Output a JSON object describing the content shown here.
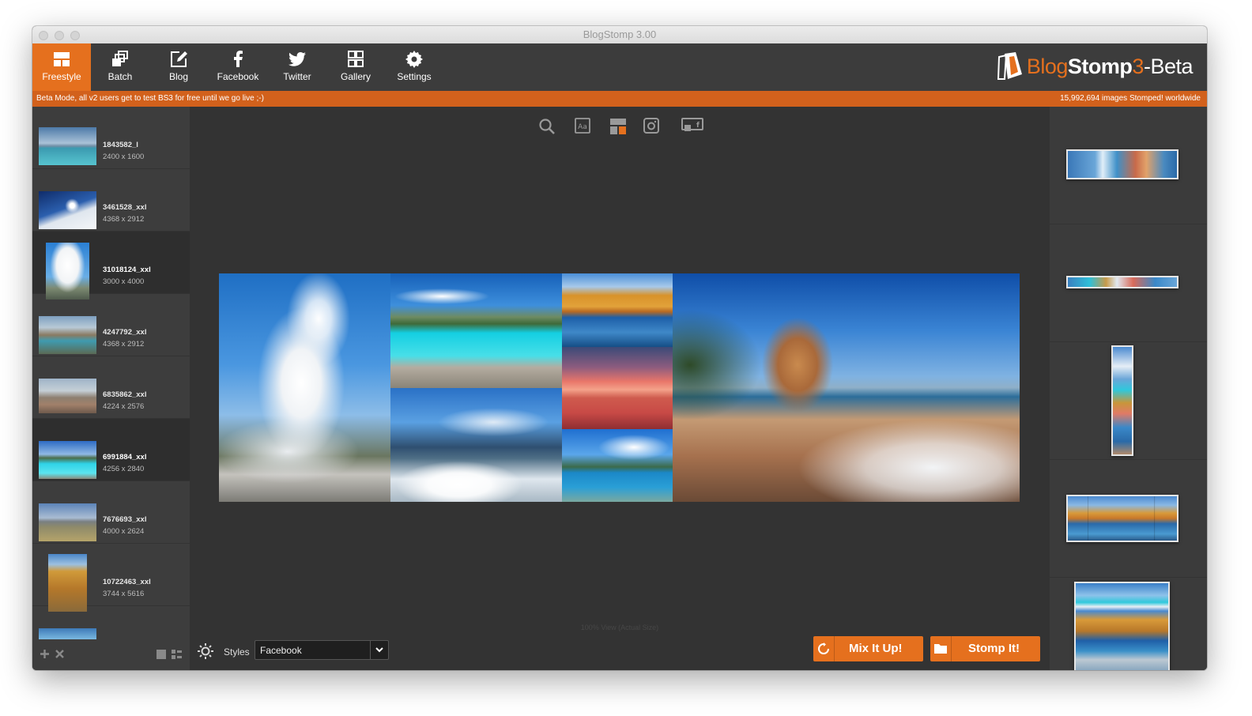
{
  "window": {
    "title": "BlogStomp 3.00"
  },
  "toolbar": {
    "items": [
      {
        "label": "Freestyle",
        "icon": "freestyle-icon",
        "active": true
      },
      {
        "label": "Batch",
        "icon": "batch-icon"
      },
      {
        "label": "Blog",
        "icon": "blog-edit-icon"
      },
      {
        "label": "Facebook",
        "icon": "facebook-icon"
      },
      {
        "label": "Twitter",
        "icon": "twitter-icon"
      },
      {
        "label": "Gallery",
        "icon": "gallery-grid-icon"
      },
      {
        "label": "Settings",
        "icon": "gear-icon"
      }
    ]
  },
  "brand": {
    "blog": "Blog",
    "stomp": "Stomp",
    "version": "3",
    "suffix": "-Beta"
  },
  "beta_bar": {
    "message": "Beta Mode, all v2 users get to test BS3 for free until we go live ;-)",
    "counter": "15,992,694 images Stomped! worldwide"
  },
  "image_list": [
    {
      "name": "1843582_l",
      "dims": "2400 x 1600"
    },
    {
      "name": "3461528_xxl",
      "dims": "4368 x 2912"
    },
    {
      "name": "31018124_xxl",
      "dims": "3000 x 4000",
      "selected": true
    },
    {
      "name": "4247792_xxl",
      "dims": "4368 x 2912"
    },
    {
      "name": "6835862_xxl",
      "dims": "4224 x 2576"
    },
    {
      "name": "6991884_xxl",
      "dims": "4256 x 2840",
      "selected": true
    },
    {
      "name": "7676693_xxl",
      "dims": "4000 x 2624"
    },
    {
      "name": "10722463_xxl",
      "dims": "3744 x 5616"
    }
  ],
  "canvas_tools": [
    "search-icon",
    "text-icon",
    "layout-icon",
    "instagram-icon",
    "facebook-cover-icon"
  ],
  "zoom_note": "100% View (Actual Size)",
  "bottom": {
    "styles_label": "Styles",
    "style_value": "Facebook",
    "mix_label": "Mix It Up!",
    "stomp_label": "Stomp It!"
  },
  "colors": {
    "accent": "#e5701e",
    "beta_bar": "#d2611c",
    "panel": "#3d3d3d",
    "canvas": "#333333"
  }
}
